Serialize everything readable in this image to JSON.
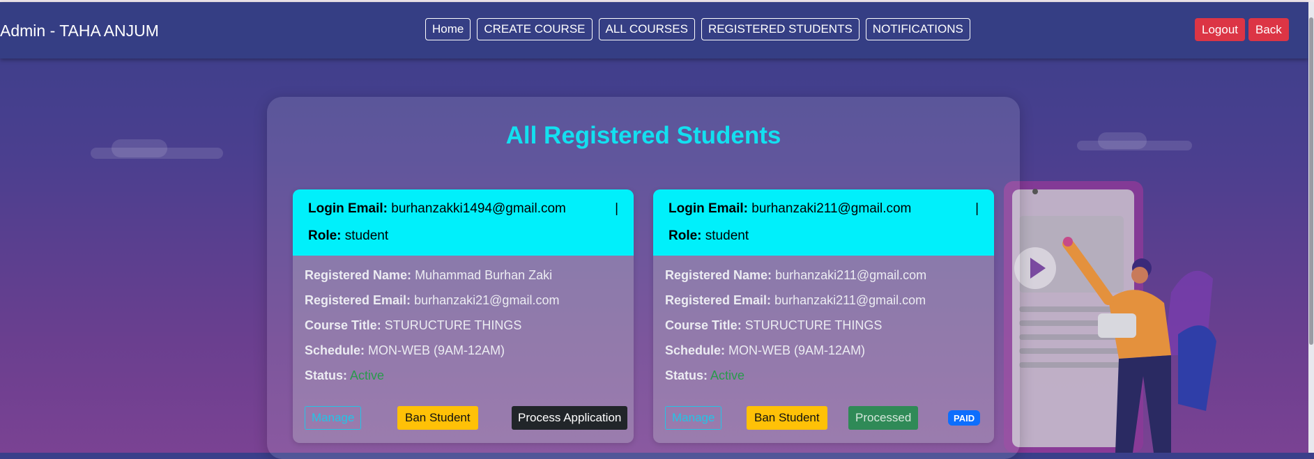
{
  "navbar": {
    "brand": "Admin - TAHA ANJUM",
    "links": [
      "Home",
      "CREATE COURSE",
      "ALL COURSES",
      "REGISTERED STUDENTS",
      "NOTIFICATIONS"
    ],
    "logout_label": "Logout",
    "back_label": "Back"
  },
  "main": {
    "title": "All Registered Students",
    "cards": [
      {
        "login_email_label": "Login Email:",
        "login_email": "burhanzakki1494@gmail.com",
        "separator": "|",
        "role_label": "Role:",
        "role": "student",
        "name_label": "Registered Name:",
        "name": "Muhammad Burhan Zaki",
        "email_label": "Registered Email:",
        "email": "burhanzaki21@gmail.com",
        "course_label": "Course Title:",
        "course": "STURUCTURE THINGS",
        "schedule_label": "Schedule:",
        "schedule": "MON-WEB (9AM-12AM)",
        "status_label": "Status:",
        "status": "Active",
        "manage_label": "Manage",
        "ban_label": "Ban Student",
        "process_label": "Process Application"
      },
      {
        "login_email_label": "Login Email:",
        "login_email": "burhanzaki211@gmail.com",
        "separator": "|",
        "role_label": "Role:",
        "role": "student",
        "name_label": "Registered Name:",
        "name": "burhanzaki211@gmail.com",
        "email_label": "Registered Email:",
        "email": "burhanzaki211@gmail.com",
        "course_label": "Course Title:",
        "course": "STURUCTURE THINGS",
        "schedule_label": "Schedule:",
        "schedule": "MON-WEB (9AM-12AM)",
        "status_label": "Status:",
        "status": "Active",
        "manage_label": "Manage",
        "ban_label": "Ban Student",
        "processed_label": "Processed",
        "paid_badge": "PAID"
      }
    ]
  },
  "colors": {
    "navbar": "#353e84",
    "accent_title": "#13e0f0",
    "card_header": "#00f0fb",
    "danger": "#dc3545",
    "warning": "#ffc107",
    "success": "#2f8a57",
    "primary": "#0d6efd"
  }
}
